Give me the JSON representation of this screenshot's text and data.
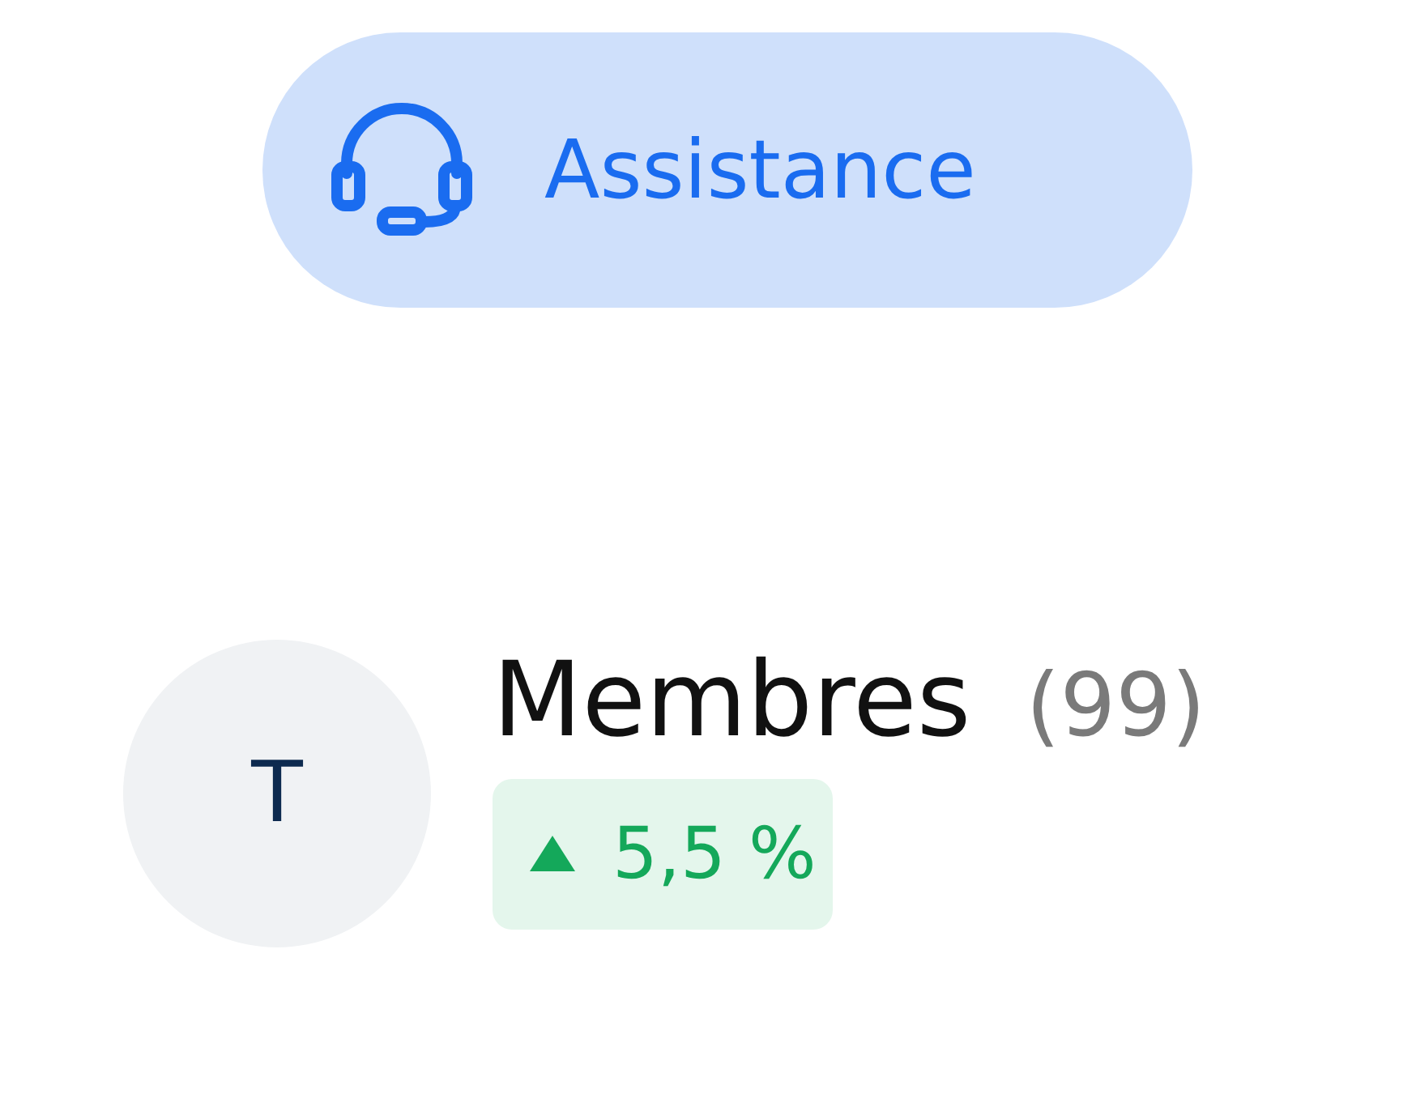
{
  "support_button": {
    "label": "Assistance"
  },
  "member": {
    "avatar_initial": "T",
    "title": "Membres",
    "count": "(99)",
    "change": {
      "kind": "increase",
      "value": "5,5 %"
    }
  }
}
